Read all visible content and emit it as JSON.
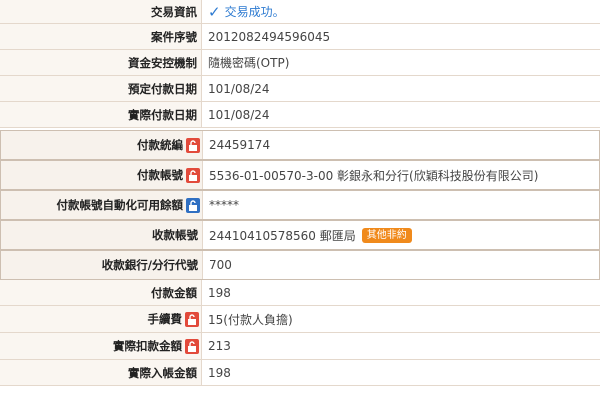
{
  "rows": [
    {
      "label": "交易資訊",
      "value": "交易成功。"
    },
    {
      "label": "案件序號",
      "value": "2012082494596045"
    },
    {
      "label": "資金安控機制",
      "value": "隨機密碼(OTP)"
    },
    {
      "label": "預定付款日期",
      "value": "101/08/24"
    },
    {
      "label": "實際付款日期",
      "value": "101/08/24"
    },
    {
      "label": "付款統編",
      "value": "24459174"
    },
    {
      "label": "付款帳號",
      "value": "5536-01-00570-3-00 彰銀永和分行(欣穎科技股份有限公司)"
    },
    {
      "label": "付款帳號自動化可用餘額",
      "value": "*****"
    },
    {
      "label": "收款帳號",
      "value": "24410410578560 郵匯局",
      "tag": "其他非約"
    },
    {
      "label": "收款銀行/分行代號",
      "value": "700"
    },
    {
      "label": "付款金額",
      "value": "198"
    },
    {
      "label": "手續費",
      "value": "15(付款人負擔)"
    },
    {
      "label": "實際扣款金額",
      "value": "213"
    },
    {
      "label": "實際入帳金額",
      "value": "198"
    }
  ],
  "icons": {
    "success": "check-icon",
    "locked": "lock-icon",
    "locked_blue": "lock-icon"
  },
  "colors": {
    "accent_blue": "#2e7bd1",
    "lock_red": "#e24a3b",
    "lock_blue": "#2f6fc2",
    "tag_orange": "#f08a1c"
  }
}
